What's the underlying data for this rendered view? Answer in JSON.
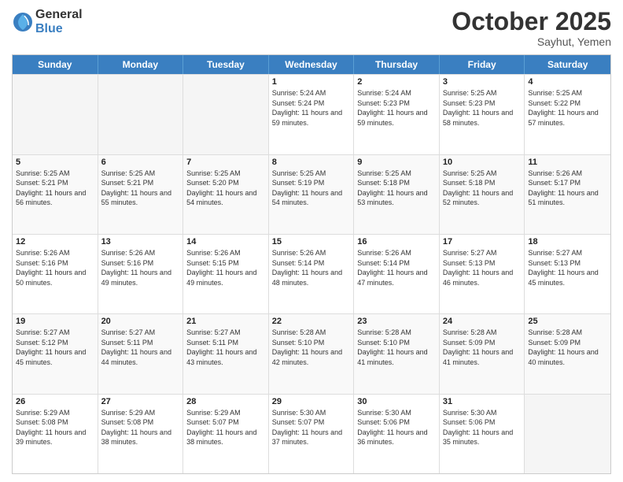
{
  "logo": {
    "general": "General",
    "blue": "Blue"
  },
  "header": {
    "month": "October 2025",
    "location": "Sayhut, Yemen"
  },
  "days": [
    "Sunday",
    "Monday",
    "Tuesday",
    "Wednesday",
    "Thursday",
    "Friday",
    "Saturday"
  ],
  "rows": [
    [
      {
        "day": "",
        "empty": true
      },
      {
        "day": "",
        "empty": true
      },
      {
        "day": "",
        "empty": true
      },
      {
        "day": "1",
        "sunrise": "5:24 AM",
        "sunset": "5:24 PM",
        "daylight": "11 hours and 59 minutes."
      },
      {
        "day": "2",
        "sunrise": "5:24 AM",
        "sunset": "5:23 PM",
        "daylight": "11 hours and 59 minutes."
      },
      {
        "day": "3",
        "sunrise": "5:25 AM",
        "sunset": "5:23 PM",
        "daylight": "11 hours and 58 minutes."
      },
      {
        "day": "4",
        "sunrise": "5:25 AM",
        "sunset": "5:22 PM",
        "daylight": "11 hours and 57 minutes."
      }
    ],
    [
      {
        "day": "5",
        "sunrise": "5:25 AM",
        "sunset": "5:21 PM",
        "daylight": "11 hours and 56 minutes."
      },
      {
        "day": "6",
        "sunrise": "5:25 AM",
        "sunset": "5:21 PM",
        "daylight": "11 hours and 55 minutes."
      },
      {
        "day": "7",
        "sunrise": "5:25 AM",
        "sunset": "5:20 PM",
        "daylight": "11 hours and 54 minutes."
      },
      {
        "day": "8",
        "sunrise": "5:25 AM",
        "sunset": "5:19 PM",
        "daylight": "11 hours and 54 minutes."
      },
      {
        "day": "9",
        "sunrise": "5:25 AM",
        "sunset": "5:18 PM",
        "daylight": "11 hours and 53 minutes."
      },
      {
        "day": "10",
        "sunrise": "5:25 AM",
        "sunset": "5:18 PM",
        "daylight": "11 hours and 52 minutes."
      },
      {
        "day": "11",
        "sunrise": "5:26 AM",
        "sunset": "5:17 PM",
        "daylight": "11 hours and 51 minutes."
      }
    ],
    [
      {
        "day": "12",
        "sunrise": "5:26 AM",
        "sunset": "5:16 PM",
        "daylight": "11 hours and 50 minutes."
      },
      {
        "day": "13",
        "sunrise": "5:26 AM",
        "sunset": "5:16 PM",
        "daylight": "11 hours and 49 minutes."
      },
      {
        "day": "14",
        "sunrise": "5:26 AM",
        "sunset": "5:15 PM",
        "daylight": "11 hours and 49 minutes."
      },
      {
        "day": "15",
        "sunrise": "5:26 AM",
        "sunset": "5:14 PM",
        "daylight": "11 hours and 48 minutes."
      },
      {
        "day": "16",
        "sunrise": "5:26 AM",
        "sunset": "5:14 PM",
        "daylight": "11 hours and 47 minutes."
      },
      {
        "day": "17",
        "sunrise": "5:27 AM",
        "sunset": "5:13 PM",
        "daylight": "11 hours and 46 minutes."
      },
      {
        "day": "18",
        "sunrise": "5:27 AM",
        "sunset": "5:13 PM",
        "daylight": "11 hours and 45 minutes."
      }
    ],
    [
      {
        "day": "19",
        "sunrise": "5:27 AM",
        "sunset": "5:12 PM",
        "daylight": "11 hours and 45 minutes."
      },
      {
        "day": "20",
        "sunrise": "5:27 AM",
        "sunset": "5:11 PM",
        "daylight": "11 hours and 44 minutes."
      },
      {
        "day": "21",
        "sunrise": "5:27 AM",
        "sunset": "5:11 PM",
        "daylight": "11 hours and 43 minutes."
      },
      {
        "day": "22",
        "sunrise": "5:28 AM",
        "sunset": "5:10 PM",
        "daylight": "11 hours and 42 minutes."
      },
      {
        "day": "23",
        "sunrise": "5:28 AM",
        "sunset": "5:10 PM",
        "daylight": "11 hours and 41 minutes."
      },
      {
        "day": "24",
        "sunrise": "5:28 AM",
        "sunset": "5:09 PM",
        "daylight": "11 hours and 41 minutes."
      },
      {
        "day": "25",
        "sunrise": "5:28 AM",
        "sunset": "5:09 PM",
        "daylight": "11 hours and 40 minutes."
      }
    ],
    [
      {
        "day": "26",
        "sunrise": "5:29 AM",
        "sunset": "5:08 PM",
        "daylight": "11 hours and 39 minutes."
      },
      {
        "day": "27",
        "sunrise": "5:29 AM",
        "sunset": "5:08 PM",
        "daylight": "11 hours and 38 minutes."
      },
      {
        "day": "28",
        "sunrise": "5:29 AM",
        "sunset": "5:07 PM",
        "daylight": "11 hours and 38 minutes."
      },
      {
        "day": "29",
        "sunrise": "5:30 AM",
        "sunset": "5:07 PM",
        "daylight": "11 hours and 37 minutes."
      },
      {
        "day": "30",
        "sunrise": "5:30 AM",
        "sunset": "5:06 PM",
        "daylight": "11 hours and 36 minutes."
      },
      {
        "day": "31",
        "sunrise": "5:30 AM",
        "sunset": "5:06 PM",
        "daylight": "11 hours and 35 minutes."
      },
      {
        "day": "",
        "empty": true
      }
    ]
  ]
}
